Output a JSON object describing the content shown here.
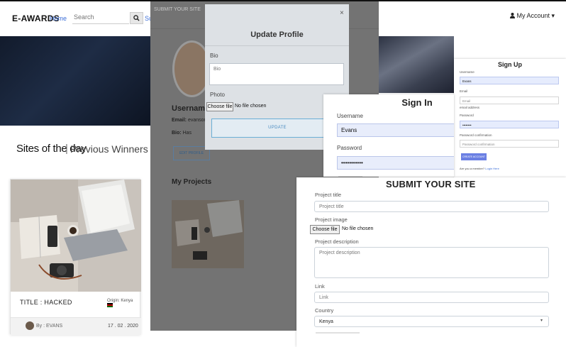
{
  "nav": {
    "brand": "E-AWARDS",
    "home": "Home",
    "search_placeholder": "Search",
    "search_icon": "search-icon",
    "submit_link": "Sub",
    "account": "My Account ▾",
    "account_icon": "user-icon"
  },
  "main": {
    "sites_of_the_day": "Sites of the day",
    "separator": "|",
    "previous_winners": "Previous Winners",
    "card": {
      "title": "TITLE : HACKED",
      "origin": "Origin: Kenya",
      "author": "By : EVANS",
      "date": "17 . 02 . 2020"
    }
  },
  "profile_bg": {
    "submit_link": "SUBMIT YOUR SITE",
    "username_label": "Username:",
    "email_label": "Email:",
    "email_value": "evansonc",
    "bio_label": "Bio:",
    "bio_value": "Has",
    "edit_button": "EDIT PROFILE",
    "projects_heading": "My Projects"
  },
  "modal": {
    "close": "×",
    "title": "Update Profile",
    "bio_label": "Bio",
    "bio_placeholder": "Bio",
    "photo_label": "Photo",
    "choose_file": "Choose file",
    "no_file": "No file chosen",
    "update_button": "UPDATE"
  },
  "signup": {
    "title": "Sign Up",
    "username_label": "Username",
    "username_value": "Evans",
    "email_label": "Email",
    "email_placeholder": "Email",
    "email_hint": "email address",
    "password_label": "Password",
    "password_value": "••••••••",
    "confirm_label": "Password confirmation",
    "confirm_placeholder": "Password confirmation",
    "button": "CREATE ACCOUNT",
    "member_text": "Are you a member?",
    "login_link": "Login Here"
  },
  "signin": {
    "title": "Sign In",
    "username_label": "Username",
    "username_value": "Evans",
    "password_label": "Password",
    "password_value": "•••••••••••"
  },
  "submit_form": {
    "title": "SUBMIT YOUR SITE",
    "project_title_label": "Project title",
    "project_title_placeholder": "Project title",
    "project_image_label": "Project image",
    "choose_file": "Choose file",
    "no_file": "No file chosen",
    "description_label": "Project description",
    "description_placeholder": "Project description",
    "link_label": "Link",
    "link_placeholder": "Link",
    "country_label": "Country",
    "country_value": "Kenya"
  }
}
